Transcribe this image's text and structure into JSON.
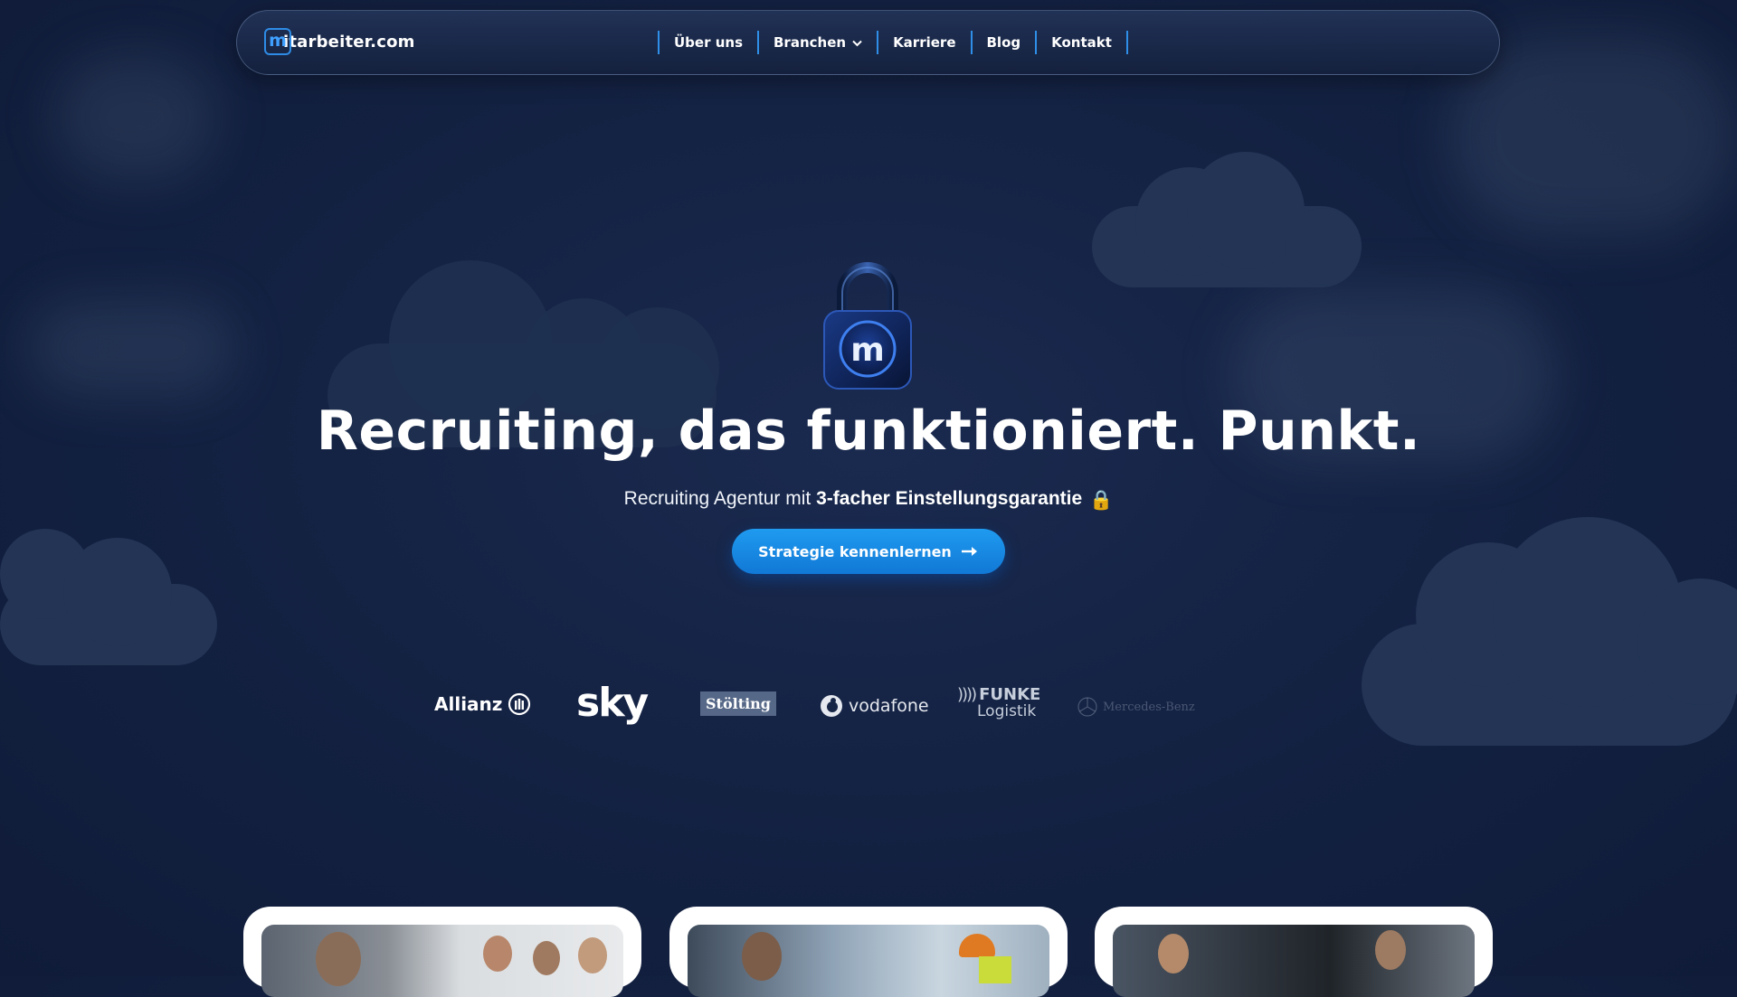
{
  "nav": {
    "logo_mark": "m",
    "logo_text": "itarbeiter.com",
    "items": [
      {
        "label": "Über uns"
      },
      {
        "label": "Branchen",
        "has_dropdown": true
      },
      {
        "label": "Karriere"
      },
      {
        "label": "Blog"
      },
      {
        "label": "Kontakt"
      }
    ]
  },
  "hero": {
    "lock_letter": "m",
    "headline": "Recruiting, das funktioniert. Punkt.",
    "sub_prefix": "Recruiting Agentur mit ",
    "sub_bold": "3-facher Einstellungsgarantie",
    "sub_icon": "🔒",
    "cta_label": "Strategie kennenlernen"
  },
  "brands": {
    "allianz": "Allianz",
    "sky": "sky",
    "stolting": "Stölting",
    "vodafone": "vodafone",
    "funke_line1": "FUNKE",
    "funke_line2": "Logistik",
    "mercedes": "Mercedes-Benz"
  },
  "colors": {
    "accent": "#1a8fe8",
    "background": "#142243",
    "nav_separator": "#2f8fe8"
  },
  "icons": [
    "chevron-down-icon",
    "arrow-right-icon",
    "padlock-icon",
    "lock-emoji-icon"
  ]
}
